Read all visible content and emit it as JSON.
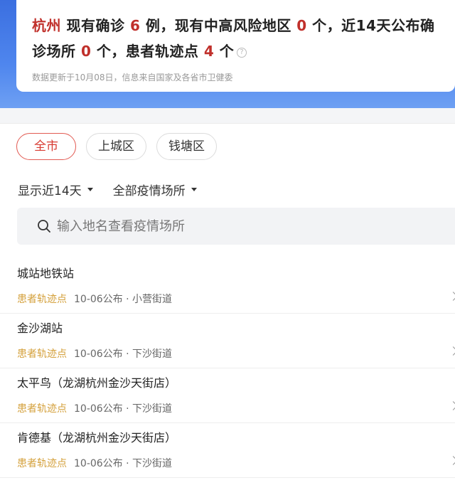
{
  "summary": {
    "city": "杭州",
    "t1": " 现有确诊 ",
    "confirmed": "6",
    "t2": " 例，现有中高风险地区 ",
    "risk_areas": "0",
    "t3": " 个，近14天公布确诊场所 ",
    "venues": "0",
    "t4": " 个，患者轨迹点 ",
    "track_points": "4",
    "t5": " 个",
    "help_icon": "?",
    "update_note": "数据更新于10月08日，信息来自国家及各省市卫健委"
  },
  "district_chips": [
    {
      "label": "全市",
      "active": true
    },
    {
      "label": "上城区",
      "active": false
    },
    {
      "label": "钱塘区",
      "active": false
    }
  ],
  "filters": {
    "time_range": "显示近14天",
    "venue_type": "全部疫情场所"
  },
  "search": {
    "placeholder": "输入地名查看疫情场所"
  },
  "venues": [
    {
      "name": "城站地铁站",
      "tag": "患者轨迹点",
      "meta": "10-06公布 · 小营街道"
    },
    {
      "name": "金沙湖站",
      "tag": "患者轨迹点",
      "meta": "10-06公布 · 下沙街道"
    },
    {
      "name": "太平鸟（龙湖杭州金沙天街店）",
      "tag": "患者轨迹点",
      "meta": "10-06公布 · 下沙街道"
    },
    {
      "name": "肯德基（龙湖杭州金沙天街店）",
      "tag": "患者轨迹点",
      "meta": "10-06公布 · 下沙街道"
    }
  ],
  "colors": {
    "accent_red": "#c0302b",
    "tag_gold": "#d4a03b",
    "header_blue": "#3b6fe0"
  }
}
